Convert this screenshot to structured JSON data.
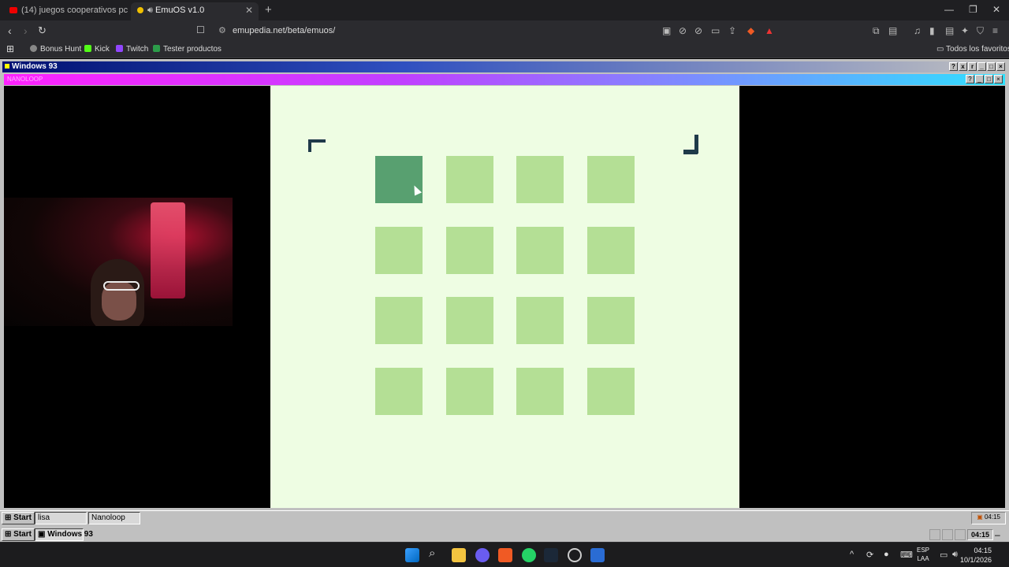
{
  "browser": {
    "tabs": [
      {
        "label": "(14) juegos cooperativos pc - YouTub"
      },
      {
        "label": "EmuOS v1.0"
      }
    ],
    "url": "emupedia.net/beta/emuos/",
    "bookmarks": [
      {
        "label": "Bonus Hunt"
      },
      {
        "label": "Kick"
      },
      {
        "label": "Twitch"
      },
      {
        "label": "Tester productos"
      }
    ],
    "all_favorites": "Todos los favoritos"
  },
  "w93": {
    "window_title": "Windows 93",
    "app_title": "NANOLOOP",
    "grid": {
      "rows": 4,
      "cols": 4,
      "active_cells": [
        [
          0,
          0
        ]
      ],
      "colors": {
        "bg": "#eefde3",
        "cell": "#b4df95",
        "active": "#58a070",
        "corner": "#1f3a4a"
      }
    },
    "inner_taskbar": {
      "start": "Start",
      "items": [
        "lisa",
        "Nanoloop"
      ],
      "time": "04:15"
    },
    "outer_taskbar": {
      "start": "Start",
      "item": "Windows 93",
      "time": "04:15"
    }
  },
  "system": {
    "language": "ESP",
    "layout": "LAA",
    "time": "04:15",
    "date": "10/1/2026"
  }
}
